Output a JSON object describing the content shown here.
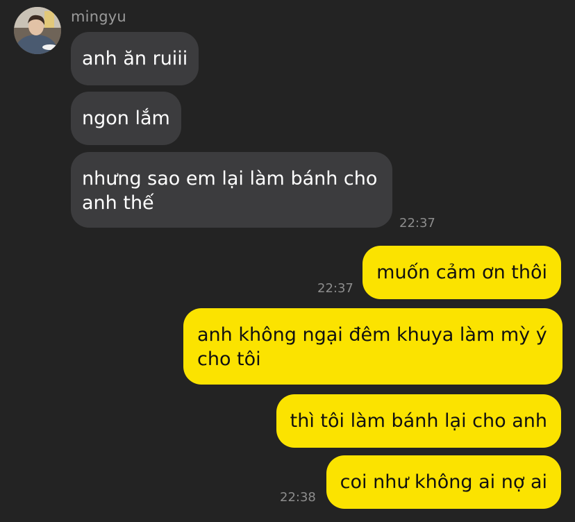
{
  "chat": {
    "sender_name": "mingyu",
    "avatar_icon": "profile-photo",
    "colors": {
      "background": "#232323",
      "incoming_bubble": "#3c3c3e",
      "outgoing_bubble": "#fbe300"
    }
  },
  "messages": [
    {
      "direction": "incoming",
      "text": "anh ăn ruiii"
    },
    {
      "direction": "incoming",
      "text": "ngon lắm"
    },
    {
      "direction": "incoming",
      "text": "nhưng sao em lại làm bánh cho anh thế",
      "time": "22:37"
    },
    {
      "direction": "outgoing",
      "text": "muốn cảm ơn thôi",
      "time": "22:37"
    },
    {
      "direction": "outgoing",
      "text": "anh không ngại đêm khuya làm mỳ ý cho tôi"
    },
    {
      "direction": "outgoing",
      "text": "thì tôi làm bánh lại cho anh"
    },
    {
      "direction": "outgoing",
      "text": "coi như không ai nợ ai",
      "time": "22:38"
    }
  ]
}
